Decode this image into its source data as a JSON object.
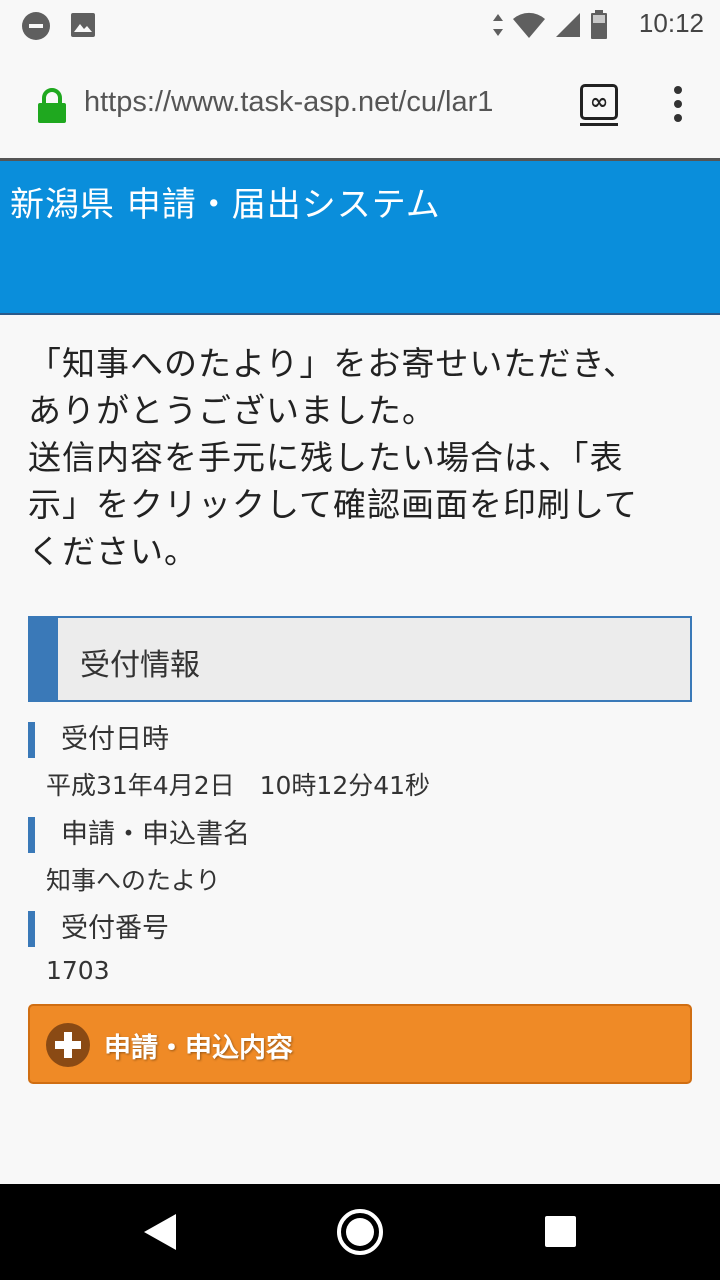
{
  "status_bar": {
    "time": "10:12",
    "icons": [
      "do-not-disturb-icon",
      "image-icon",
      "data-arrows-icon",
      "wifi-icon",
      "signal-icon",
      "battery-icon"
    ]
  },
  "browser": {
    "url": "https://www.task-asp.net/cu/lar1",
    "tab_count": "∞",
    "icons": [
      "lock-icon",
      "tabs-icon",
      "menu-icon"
    ]
  },
  "header": {
    "title": "新潟県 申請・届出システム",
    "color": "#0a8edb"
  },
  "message": {
    "lines": [
      "「知事へのたより」をお寄せいただき、",
      "ありがとうございました。",
      "送信内容を手元に残したい場合は、「表",
      "示」をクリックして確認画面を印刷して",
      "ください。"
    ]
  },
  "reception": {
    "section_title": "受付情報",
    "date_label": "受付日時",
    "date_value": "平成31年4月2日　10時12分41秒",
    "form_label": "申請・申込書名",
    "form_value": "知事へのたより",
    "number_label": "受付番号",
    "number_value": "1703"
  },
  "detail_button": {
    "label": "申請・申込内容",
    "color": "#ef8a26"
  },
  "nav_bar": {
    "icons": [
      "back-icon",
      "home-icon",
      "recent-apps-icon"
    ]
  }
}
